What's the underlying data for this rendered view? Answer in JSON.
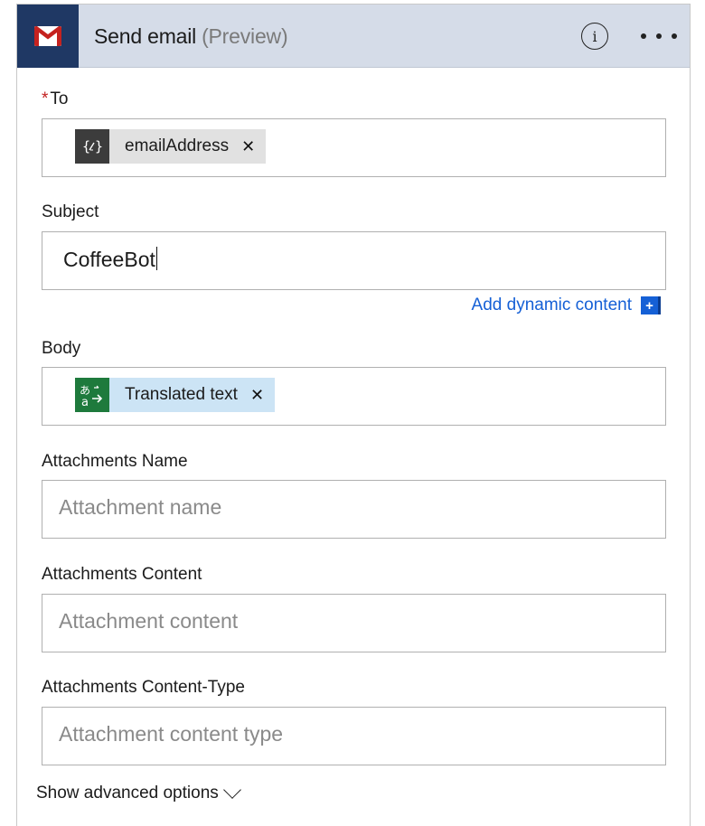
{
  "header": {
    "title": "Send email",
    "subtitle": "(Preview)",
    "logo_icon": "gmail-icon",
    "info_icon": "info-icon",
    "more_icon": "more-horizontal-icon",
    "colors": {
      "header_bg": "#d5dce8",
      "logo_bg": "#1f3864"
    }
  },
  "fields": {
    "to": {
      "label": "To",
      "required_mark": "*",
      "token": {
        "text": "emailAddress",
        "icon": "expression-braces-icon",
        "remove": "✕"
      }
    },
    "subject": {
      "label": "Subject",
      "value": "CoffeeBot"
    },
    "dynamic_content": {
      "label": "Add dynamic content",
      "icon": "+"
    },
    "body": {
      "label": "Body",
      "token": {
        "text": "Translated text",
        "icon": "translator-icon",
        "remove": "✕"
      }
    },
    "attachments_name": {
      "label": "Attachments Name",
      "placeholder": "Attachment name"
    },
    "attachments_content": {
      "label": "Attachments Content",
      "placeholder": "Attachment content"
    },
    "attachments_content_type": {
      "label": "Attachments Content-Type",
      "placeholder": "Attachment content type"
    }
  },
  "footer": {
    "advanced_label": "Show advanced options"
  },
  "colors": {
    "link": "#1560d6",
    "required": "#c2201f",
    "token_gray": "#e1e1e1",
    "token_blue": "#cce4f5",
    "translator_green": "#1e7a3c"
  }
}
